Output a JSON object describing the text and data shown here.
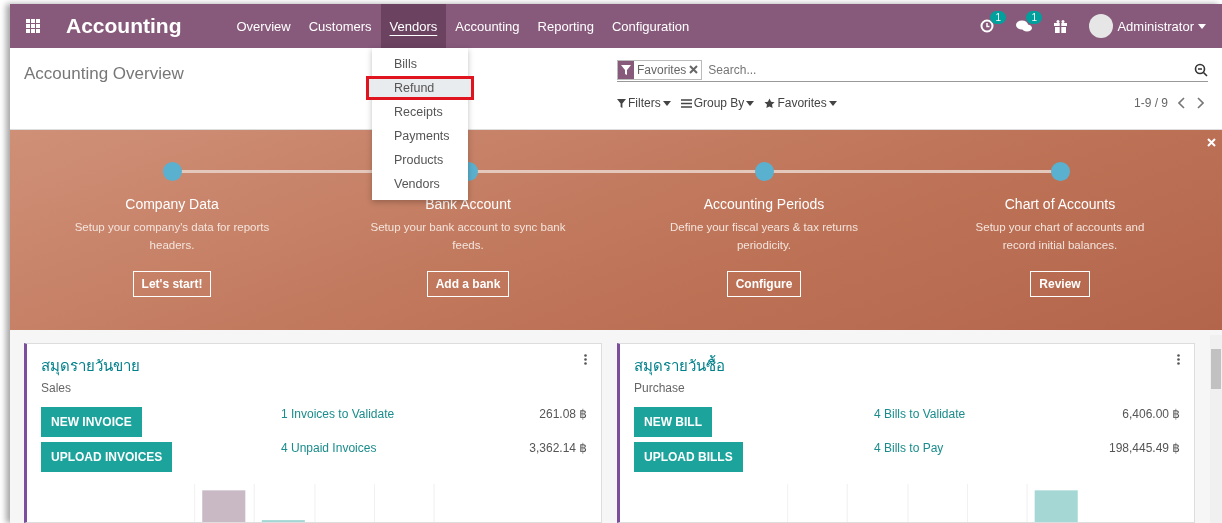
{
  "navbar": {
    "app_name": "Accounting",
    "menu": [
      {
        "label": "Overview",
        "selected": false
      },
      {
        "label": "Customers",
        "selected": false
      },
      {
        "label": "Vendors",
        "selected": true
      },
      {
        "label": "Accounting",
        "selected": false
      },
      {
        "label": "Reporting",
        "selected": false
      },
      {
        "label": "Configuration",
        "selected": false
      }
    ],
    "activity_count": "1",
    "message_count": "1",
    "user": "Administrator"
  },
  "vendors_menu": [
    {
      "label": "Bills",
      "selected": false
    },
    {
      "label": "Refund",
      "selected": true
    },
    {
      "label": "Receipts",
      "selected": false
    },
    {
      "label": "Payments",
      "selected": false
    },
    {
      "label": "Products",
      "selected": false
    },
    {
      "label": "Vendors",
      "selected": false
    }
  ],
  "control_panel": {
    "title": "Accounting Overview",
    "facet": "Favorites",
    "search_placeholder": "Search...",
    "filters": "Filters",
    "group_by": "Group By",
    "favorites": "Favorites",
    "pager": "1-9 / 9"
  },
  "onboarding": [
    {
      "title": "Company Data",
      "description": "Setup your company's data for reports headers.",
      "button": "Let's start!"
    },
    {
      "title": "Bank Account",
      "description": "Setup your bank account to sync bank feeds.",
      "button": "Add a bank"
    },
    {
      "title": "Accounting Periods",
      "description": "Define your fiscal years & tax returns periodicity.",
      "button": "Configure"
    },
    {
      "title": "Chart of Accounts",
      "description": "Setup your chart of accounts and record initial balances.",
      "button": "Review"
    }
  ],
  "journals": [
    {
      "name": "สมุดรายวันขาย",
      "type": "Sales",
      "buttons": [
        "NEW INVOICE",
        "UPLOAD INVOICES"
      ],
      "stats": [
        {
          "label": "1 Invoices to Validate",
          "amount": "261.08 ฿"
        },
        {
          "label": "4 Unpaid Invoices",
          "amount": "3,362.14 ฿"
        }
      ]
    },
    {
      "name": "สมุดรายวันซื้อ",
      "type": "Purchase",
      "buttons": [
        "NEW BILL",
        "UPLOAD BILLS"
      ],
      "stats": [
        {
          "label": "4 Bills to Validate",
          "amount": "6,406.00 ฿"
        },
        {
          "label": "4 Bills to Pay",
          "amount": "198,445.49 ฿"
        }
      ]
    }
  ]
}
